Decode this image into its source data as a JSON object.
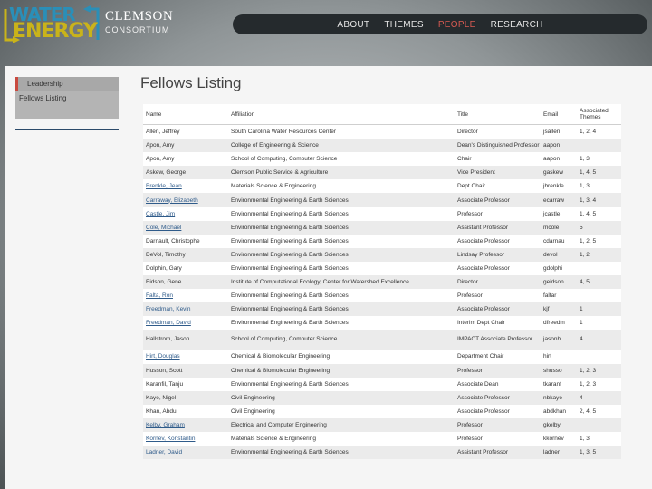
{
  "logo": {
    "word1": "WATER",
    "word2": "ENERGY",
    "org": "CLEMSON",
    "sub": "CONSORTIUM"
  },
  "nav": [
    "ABOUT",
    "THEMES",
    "PEOPLE",
    "RESEARCH"
  ],
  "sidebar": {
    "items": [
      "Leadership",
      "Fellows Listing"
    ]
  },
  "page_title": "Fellows Listing",
  "table": {
    "columns": [
      "Name",
      "Affiliation",
      "Title",
      "Email",
      "Associated Themes"
    ],
    "rows": [
      {
        "name": "Allen, Jeffrey",
        "link": false,
        "aff": "South Carolina Water Resources Center",
        "title": "Director",
        "email": "jsallen",
        "themes": "1, 2, 4"
      },
      {
        "name": "Apon, Amy",
        "link": false,
        "aff": "College of Engineering & Science",
        "title": "Dean's Distinguished Professor",
        "email": "aapon",
        "themes": ""
      },
      {
        "name": "Apon, Amy",
        "link": false,
        "aff": "School of Computing, Computer Science",
        "title": "Chair",
        "email": "aapon",
        "themes": "1, 3"
      },
      {
        "name": "Askew, George",
        "link": false,
        "aff": "Clemson Public Service & Agriculture",
        "title": "Vice President",
        "email": "gaskew",
        "themes": "1, 4, 5"
      },
      {
        "name": "Brenkle, Jean",
        "link": true,
        "aff": "Materials Science & Engineering",
        "title": "Dept Chair",
        "email": "jbrenkle",
        "themes": "1, 3"
      },
      {
        "name": "Carraway, Elizabeth",
        "link": true,
        "aff": "Environmental Engineering & Earth Sciences",
        "title": "Associate Professor",
        "email": "ecarraw",
        "themes": "1, 3, 4"
      },
      {
        "name": "Castle, Jim",
        "link": true,
        "aff": "Environmental Engineering & Earth Sciences",
        "title": "Professor",
        "email": "jcastle",
        "themes": "1, 4, 5"
      },
      {
        "name": "Cole, Michael",
        "link": true,
        "aff": "Environmental Engineering & Earth Sciences",
        "title": "Assistant Professor",
        "email": "mcole",
        "themes": "5"
      },
      {
        "name": "Darnault, Christophe",
        "link": false,
        "aff": "Environmental Engineering & Earth Sciences",
        "title": "Associate Professor",
        "email": "cdarnau",
        "themes": "1, 2, 5"
      },
      {
        "name": "DeVol, Timothy",
        "link": false,
        "aff": "Environmental Engineering & Earth Sciences",
        "title": "Lindsay Professor",
        "email": "devol",
        "themes": "1, 2"
      },
      {
        "name": "Dolphin, Gary",
        "link": false,
        "aff": "Environmental Engineering & Earth Sciences",
        "title": "Associate Professor",
        "email": "gdolphi",
        "themes": ""
      },
      {
        "name": "Eidson, Gene",
        "link": false,
        "aff": "Institute of Computational Ecology, Center for Watershed Excellence",
        "title": "Director",
        "email": "geidson",
        "themes": "4, 5"
      },
      {
        "name": "Falta, Ron",
        "link": true,
        "aff": "Environmental Engineering & Earth Sciences",
        "title": "Professor",
        "email": "faltar",
        "themes": ""
      },
      {
        "name": "Freedman, Kevin",
        "link": true,
        "aff": "Environmental Engineering & Earth Sciences",
        "title": "Associate Professor",
        "email": "kjf",
        "themes": "1"
      },
      {
        "name": "Freedman, David",
        "link": true,
        "aff": "Environmental Engineering & Earth Sciences",
        "title": "Interim Dept Chair",
        "email": "dfreedm",
        "themes": "1"
      },
      {
        "name": "Hallstrom, Jason",
        "link": false,
        "aff": "School of Computing, Computer Science",
        "title": "IMPACT Associate Professor",
        "email": "jasonh",
        "themes": "4",
        "tall": true
      },
      {
        "name": "Hirt, Douglas",
        "link": true,
        "aff": "Chemical & Biomolecular Engineering",
        "title": "Department Chair",
        "email": "hirt",
        "themes": ""
      },
      {
        "name": "Husson, Scott",
        "link": false,
        "aff": "Chemical & Biomolecular Engineering",
        "title": "Professor",
        "email": "shusso",
        "themes": "1, 2, 3"
      },
      {
        "name": "Karanfil, Tanju",
        "link": false,
        "aff": "Environmental Engineering & Earth Sciences",
        "title": "Associate Dean",
        "email": "tkaranf",
        "themes": "1, 2, 3"
      },
      {
        "name": "Kaye, Nigel",
        "link": false,
        "aff": "Civil Engineering",
        "title": "Associate Professor",
        "email": "nbkaye",
        "themes": "4"
      },
      {
        "name": "Khan, Abdul",
        "link": false,
        "aff": "Civil Engineering",
        "title": "Associate Professor",
        "email": "abdkhan",
        "themes": "2, 4, 5"
      },
      {
        "name": "Kelby, Graham",
        "link": true,
        "aff": "Electrical and Computer Engineering",
        "title": "Professor",
        "email": "gkelby",
        "themes": ""
      },
      {
        "name": "Kornev, Konstantin",
        "link": true,
        "aff": "Materials Science & Engineering",
        "title": "Professor",
        "email": "kkornev",
        "themes": "1, 3"
      },
      {
        "name": "Ladner, David",
        "link": true,
        "aff": "Environmental Engineering & Earth Sciences",
        "title": "Assistant Professor",
        "email": "ladner",
        "themes": "1, 3, 5"
      }
    ]
  }
}
